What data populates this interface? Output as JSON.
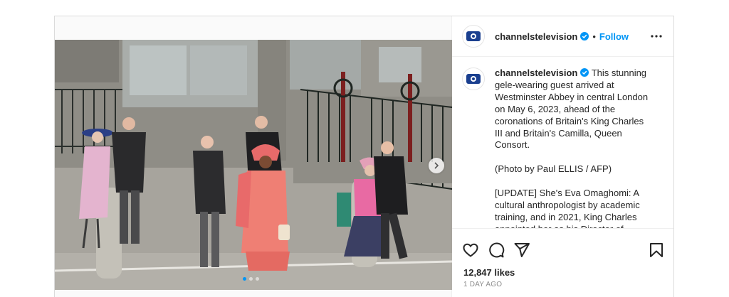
{
  "post": {
    "username": "channelstelevision",
    "separator": "•",
    "follow_label": "Follow",
    "caption": "This stunning gele-wearing guest arrived at Westminster Abbey in central London on May 6, 2023, ahead of the coronations of Britain's King Charles III and Britain's Camilla, Queen Consort.\n\n(Photo by Paul ELLIS / AFP)\n\n[UPDATE] She's Eva Omaghomi: A cultural anthropologist by academic training, and in 2021, King Charles appointed her as his Director of Community Engagement.",
    "likes": "12,847 likes",
    "timestamp": "1 DAY AGO"
  },
  "media": {
    "slide_count": 3,
    "active_slide": 1
  },
  "icons": {
    "verified": "verified-badge-icon",
    "more": "more-options-icon",
    "like": "heart-icon",
    "comment": "comment-icon",
    "share": "share-icon",
    "save": "bookmark-icon",
    "next": "chevron-right-icon"
  },
  "colors": {
    "accent": "#0095f6",
    "muted": "#8e8e8e",
    "text": "#262626",
    "gele": "#e86a6a"
  }
}
